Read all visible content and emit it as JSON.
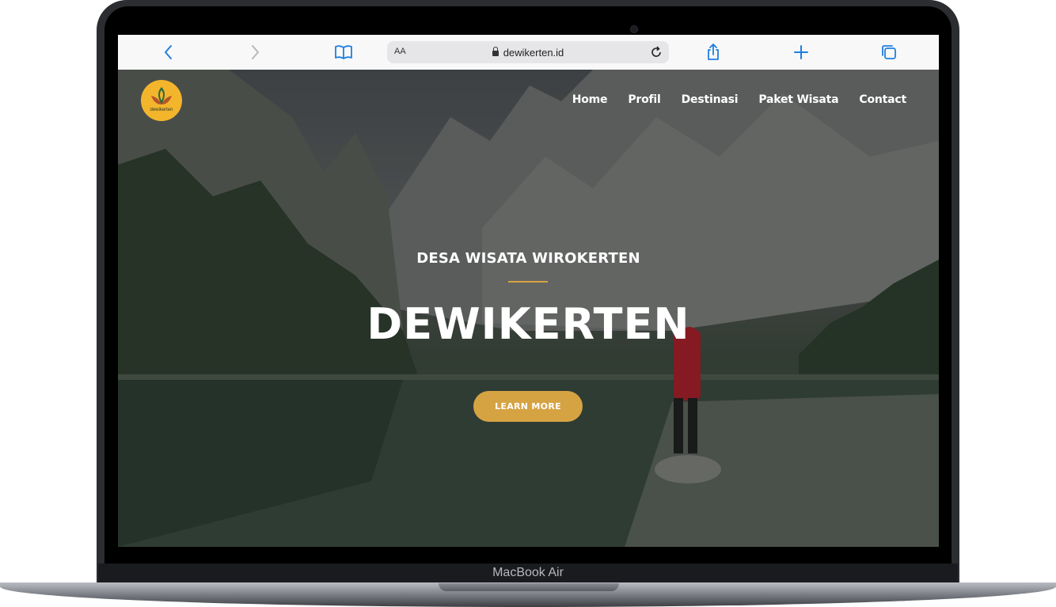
{
  "device": {
    "model_label": "MacBook Air"
  },
  "browser": {
    "url_display": "dewikerten.id",
    "text_size_label": "AA",
    "icons": [
      "back-icon",
      "forward-icon",
      "bookmarks-icon",
      "lock-icon",
      "reload-icon",
      "share-icon",
      "new-tab-icon",
      "tabs-icon"
    ]
  },
  "site": {
    "logo_text": "dewikerten",
    "nav": [
      {
        "label": "Home"
      },
      {
        "label": "Profil"
      },
      {
        "label": "Destinasi"
      },
      {
        "label": "Paket Wisata"
      },
      {
        "label": "Contact"
      }
    ],
    "hero": {
      "subtitle": "DESA WISATA WIROKERTEN",
      "title": "DEWIKERTEN",
      "cta_label": "LEARN MORE"
    }
  },
  "colors": {
    "accent": "#d6a343",
    "logo_bg": "#f3b52c",
    "toolbar_icons": "#1f7fe0"
  }
}
